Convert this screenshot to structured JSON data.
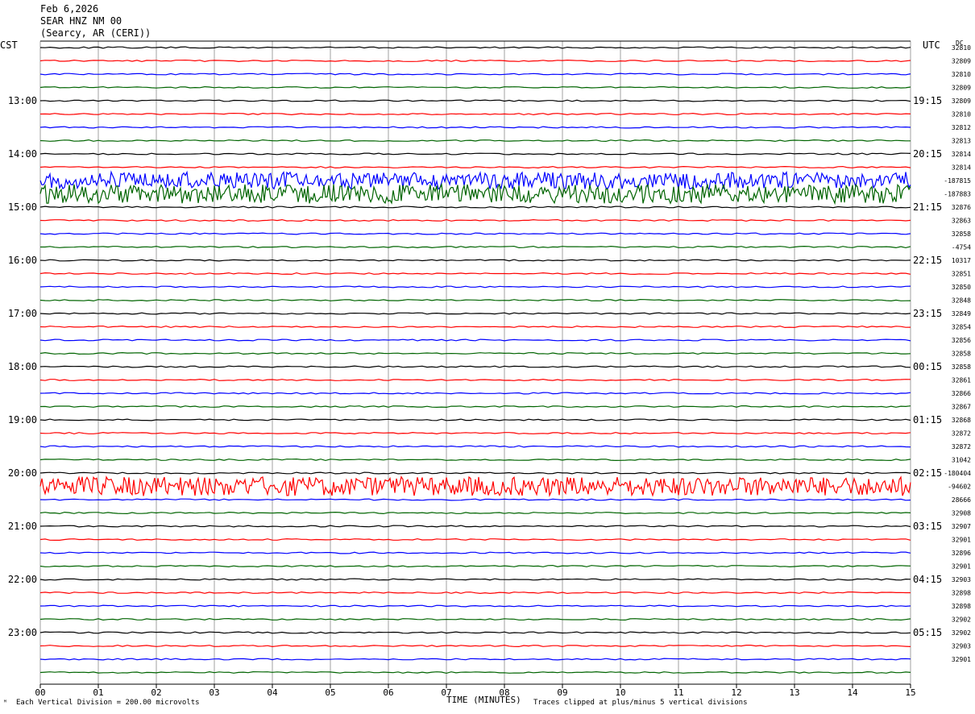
{
  "header": {
    "date": "Feb 6,2026",
    "station": "SEAR HNZ NM 00",
    "location": "(Searcy, AR (CERI))"
  },
  "left_zone": "CST",
  "right_zone": "UTC",
  "dc_label": "DC",
  "footer": {
    "division": "Each Vertical Division =  200.00 microvolts",
    "clip": "Traces clipped at plus/minus 5 vertical divisions",
    "corner_mark": "ᴹ"
  },
  "colors": {
    "cycle": [
      "#000000",
      "#ff0000",
      "#0000ff",
      "#006400"
    ],
    "grid": "#a0a0a0"
  },
  "chart_data": {
    "type": "line",
    "title": "",
    "xlabel": "TIME (MINUTES)",
    "x_ticks": [
      "00",
      "01",
      "02",
      "03",
      "04",
      "05",
      "06",
      "07",
      "08",
      "09",
      "10",
      "11",
      "12",
      "13",
      "14",
      "15"
    ],
    "xlim": [
      0,
      15
    ],
    "left_hour_labels": [
      "13:00",
      "14:00",
      "15:00",
      "16:00",
      "17:00",
      "18:00",
      "19:00",
      "20:00",
      "21:00",
      "22:00",
      "23:00"
    ],
    "right_hour_labels": [
      "19:15",
      "20:15",
      "21:15",
      "22:15",
      "23:15",
      "00:15",
      "01:15",
      "02:15",
      "03:15",
      "04:15",
      "05:15"
    ],
    "first_labeled_trace": 4,
    "trace_count": 48,
    "dc_offsets": [
      "32810",
      "32809",
      "32810",
      "32809",
      "32809",
      "32810",
      "32812",
      "32813",
      "32814",
      "32814",
      "-187815",
      "-187883",
      "32876",
      "32863",
      "32858",
      "-4754",
      "10317",
      "32851",
      "32850",
      "32848",
      "32849",
      "32854",
      "32856",
      "32858",
      "32858",
      "32861",
      "32866",
      "32867",
      "32868",
      "32872",
      "32872",
      "31042",
      "-180404",
      "-94602",
      "28666",
      "32908",
      "32907",
      "32901",
      "32896",
      "32901",
      "32903",
      "32898",
      "32898",
      "32902",
      "32902",
      "32903",
      "32901"
    ],
    "grid": true,
    "noisy_traces": [
      {
        "index": 10,
        "color": "blue",
        "amplitude_divisions": 0.4
      },
      {
        "index": 11,
        "color": "green",
        "amplitude_divisions": 0.45
      },
      {
        "index": 33,
        "color": "red",
        "amplitude_divisions": 0.45
      }
    ]
  }
}
